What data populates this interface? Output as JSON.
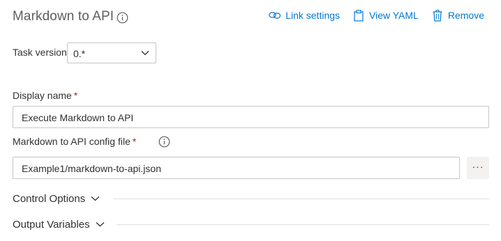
{
  "header": {
    "title": "Markdown to API",
    "actions": {
      "link_settings": "Link settings",
      "view_yaml": "View YAML",
      "remove": "Remove"
    }
  },
  "task_version": {
    "label": "Task version",
    "value": "0.*"
  },
  "display_name": {
    "label": "Display name",
    "required_marker": "*",
    "value": "Execute Markdown to API"
  },
  "config_file": {
    "label": "Markdown to API config file",
    "required_marker": "*",
    "value": "Example1/markdown-to-api.json",
    "browse_label": "···"
  },
  "sections": {
    "control_options": "Control Options",
    "output_variables": "Output Variables"
  },
  "colors": {
    "accent": "#0078d4",
    "required": "#a4262c",
    "text": "#323130",
    "border": "#c8c6c4"
  }
}
